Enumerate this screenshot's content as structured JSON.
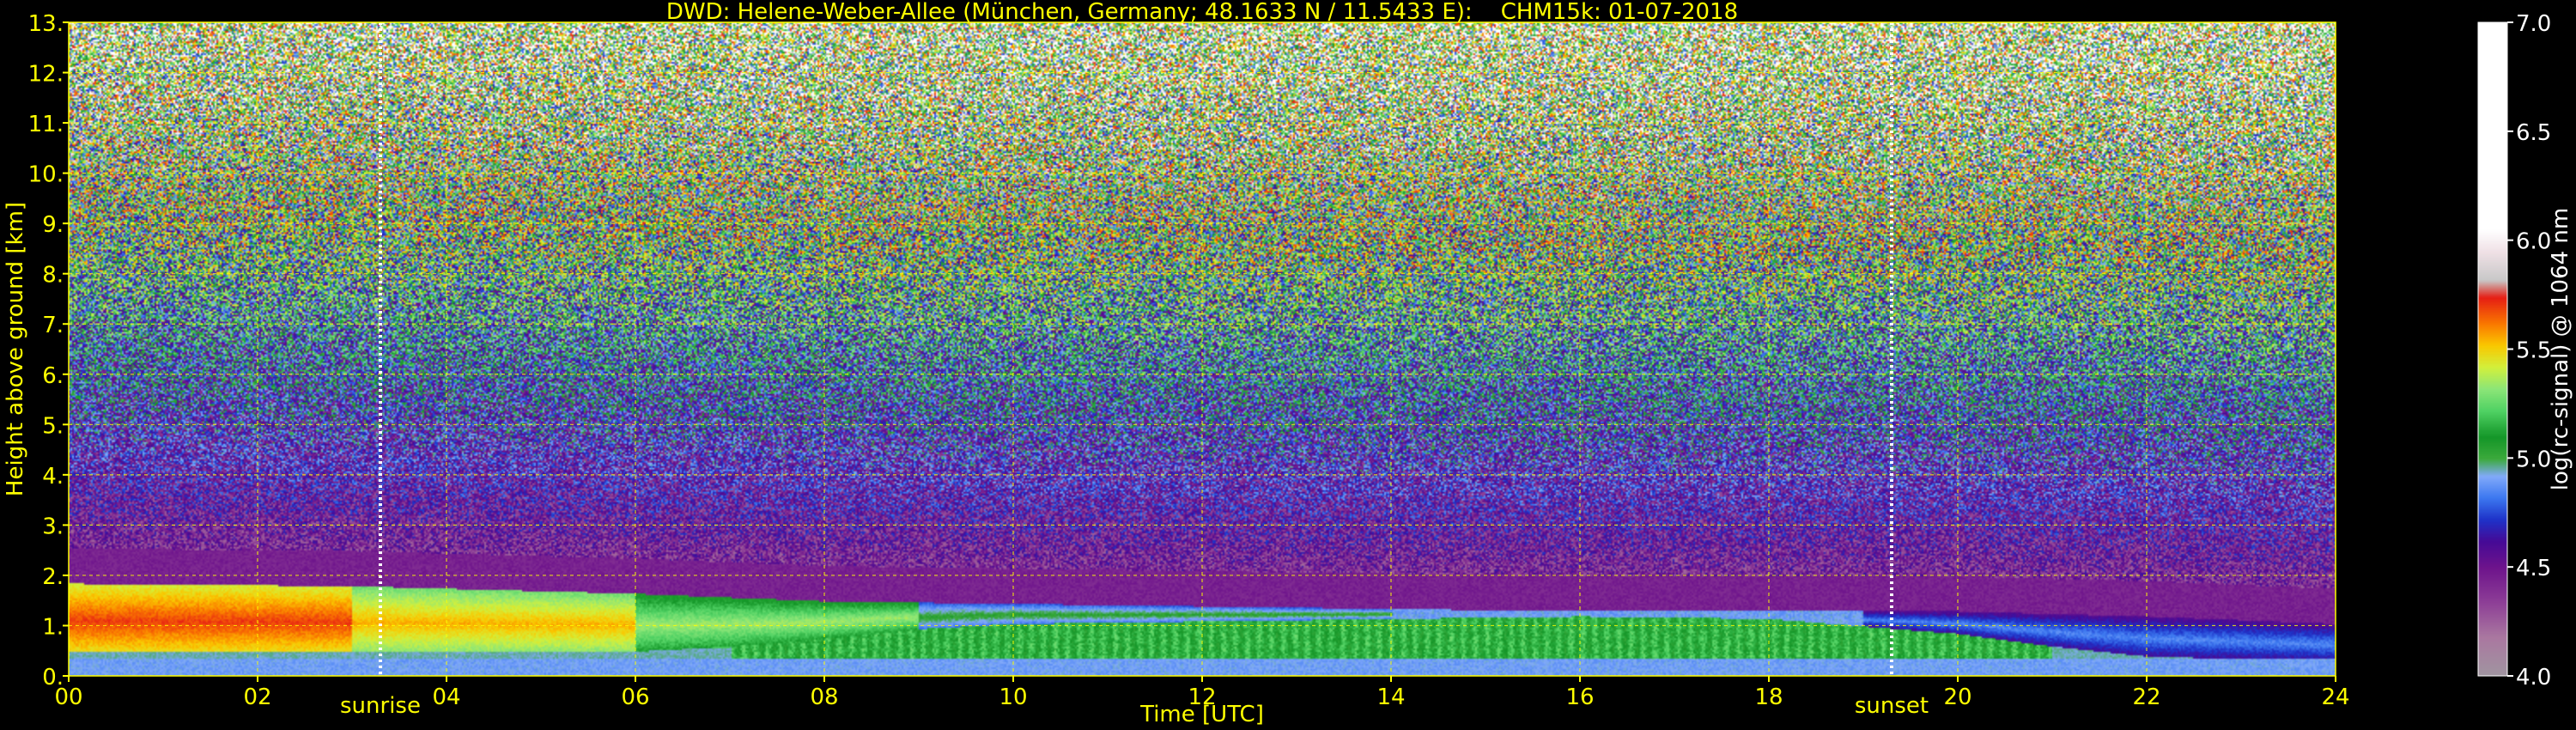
{
  "chart_data": {
    "type": "heatmap",
    "title": "DWD: Helene-Weber-Allee (München, Germany; 48.1633 N / 11.5433 E):    CHM15k: 01-07-2018",
    "xlabel": "Time [UTC]",
    "ylabel": "Height above ground [km]",
    "xlim": [
      0,
      24
    ],
    "ylim": [
      0,
      13
    ],
    "x_ticks": [
      0,
      2,
      4,
      6,
      8,
      10,
      12,
      14,
      16,
      18,
      20,
      22,
      24
    ],
    "x_tick_labels": [
      "00",
      "02",
      "04",
      "06",
      "08",
      "10",
      "12",
      "14",
      "16",
      "18",
      "20",
      "22",
      "24"
    ],
    "y_ticks": [
      0,
      1,
      2,
      3,
      4,
      5,
      6,
      7,
      8,
      9,
      10,
      11,
      12,
      13
    ],
    "y_tick_labels": [
      "0.",
      "1.",
      "2.",
      "3.",
      "4.",
      "5.",
      "6.",
      "7.",
      "8.",
      "9.",
      "10.",
      "11.",
      "12.",
      "13."
    ],
    "grid": true,
    "markers": [
      {
        "label": "sunrise",
        "x": 3.3
      },
      {
        "label": "sunset",
        "x": 19.3
      }
    ],
    "colorbar": {
      "label": "log(rc-signal) @ 1064 nm",
      "range": [
        4.0,
        7.0
      ],
      "ticks": [
        4.0,
        4.5,
        5.0,
        5.5,
        6.0,
        6.5,
        7.0
      ],
      "tick_labels": [
        "4.0",
        "4.5",
        "5.0",
        "5.5",
        "6.0",
        "6.5",
        "7.0"
      ]
    },
    "layers": {
      "residual_layer_top_km": [
        [
          0,
          1.85
        ],
        [
          3,
          1.8
        ],
        [
          6,
          1.65
        ],
        [
          8,
          1.5
        ],
        [
          10,
          1.45
        ],
        [
          12,
          1.4
        ],
        [
          14,
          1.35
        ],
        [
          16,
          1.3
        ],
        [
          18,
          1.3
        ],
        [
          20,
          1.3
        ],
        [
          22,
          1.2
        ],
        [
          24,
          1.05
        ]
      ],
      "mixing_layer_top_km": [
        [
          0,
          0.5
        ],
        [
          6,
          0.5
        ],
        [
          7,
          0.6
        ],
        [
          8,
          0.75
        ],
        [
          9,
          0.95
        ],
        [
          10,
          1.05
        ],
        [
          12,
          1.1
        ],
        [
          14,
          1.15
        ],
        [
          16,
          1.2
        ],
        [
          18,
          1.15
        ],
        [
          19,
          1.0
        ],
        [
          20,
          0.85
        ],
        [
          21,
          0.6
        ],
        [
          22,
          0.4
        ],
        [
          24,
          0.3
        ]
      ]
    }
  },
  "colors": {
    "text": "#ffff00",
    "grid": "#ffff00",
    "background": "#000000",
    "marker_line": "#ffffff",
    "colorbar_text": "#ffffff"
  }
}
